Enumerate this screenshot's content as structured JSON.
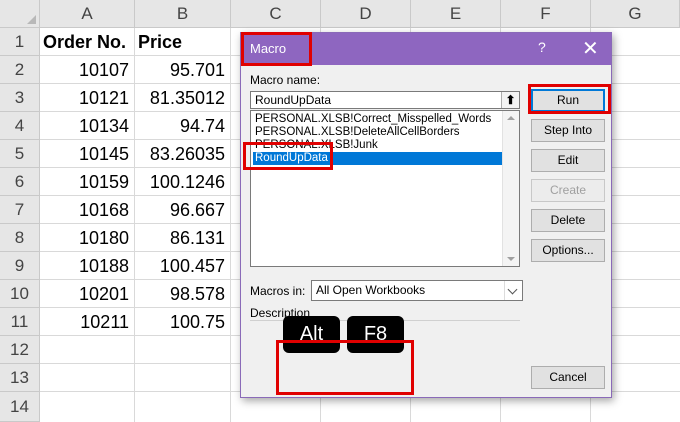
{
  "sheet": {
    "columns": [
      "A",
      "B",
      "C",
      "D",
      "E",
      "F",
      "G"
    ],
    "rows": [
      "1",
      "2",
      "3",
      "4",
      "5",
      "6",
      "7",
      "8",
      "9",
      "10",
      "11",
      "12",
      "13",
      "14"
    ],
    "headers": {
      "order_no": "Order No.",
      "price": "Price"
    },
    "data": [
      {
        "order": "10107",
        "price": "95.701"
      },
      {
        "order": "10121",
        "price": "81.35012"
      },
      {
        "order": "10134",
        "price": "94.74"
      },
      {
        "order": "10145",
        "price": "83.26035"
      },
      {
        "order": "10159",
        "price": "100.1246"
      },
      {
        "order": "10168",
        "price": "96.667"
      },
      {
        "order": "10180",
        "price": "86.131"
      },
      {
        "order": "10188",
        "price": "100.457"
      },
      {
        "order": "10201",
        "price": "98.578"
      },
      {
        "order": "10211",
        "price": "100.75"
      }
    ]
  },
  "dialog": {
    "title": "Macro",
    "help": "?",
    "close": "✕",
    "macro_name_label": "Macro name:",
    "macro_name_value": "RoundUpData",
    "list_items": [
      "PERSONAL.XLSB!Correct_Misspelled_Words",
      "PERSONAL.XLSB!DeleteAllCellBorders",
      "PERSONAL.XLSB!Junk",
      "RoundUpData"
    ],
    "selected_index": 3,
    "buttons": {
      "run": "Run",
      "step_into": "Step Into",
      "edit": "Edit",
      "create": "Create",
      "delete": "Delete",
      "options": "Options...",
      "cancel": "Cancel"
    },
    "macros_in_label": "Macros in:",
    "macros_in_value": "All Open Workbooks",
    "description_label": "Description"
  },
  "shortcut_keys": [
    "Alt",
    "F8"
  ],
  "colors": {
    "title_bar": "#8e66c0",
    "selection": "#0078d7",
    "highlight": "#e00000"
  }
}
